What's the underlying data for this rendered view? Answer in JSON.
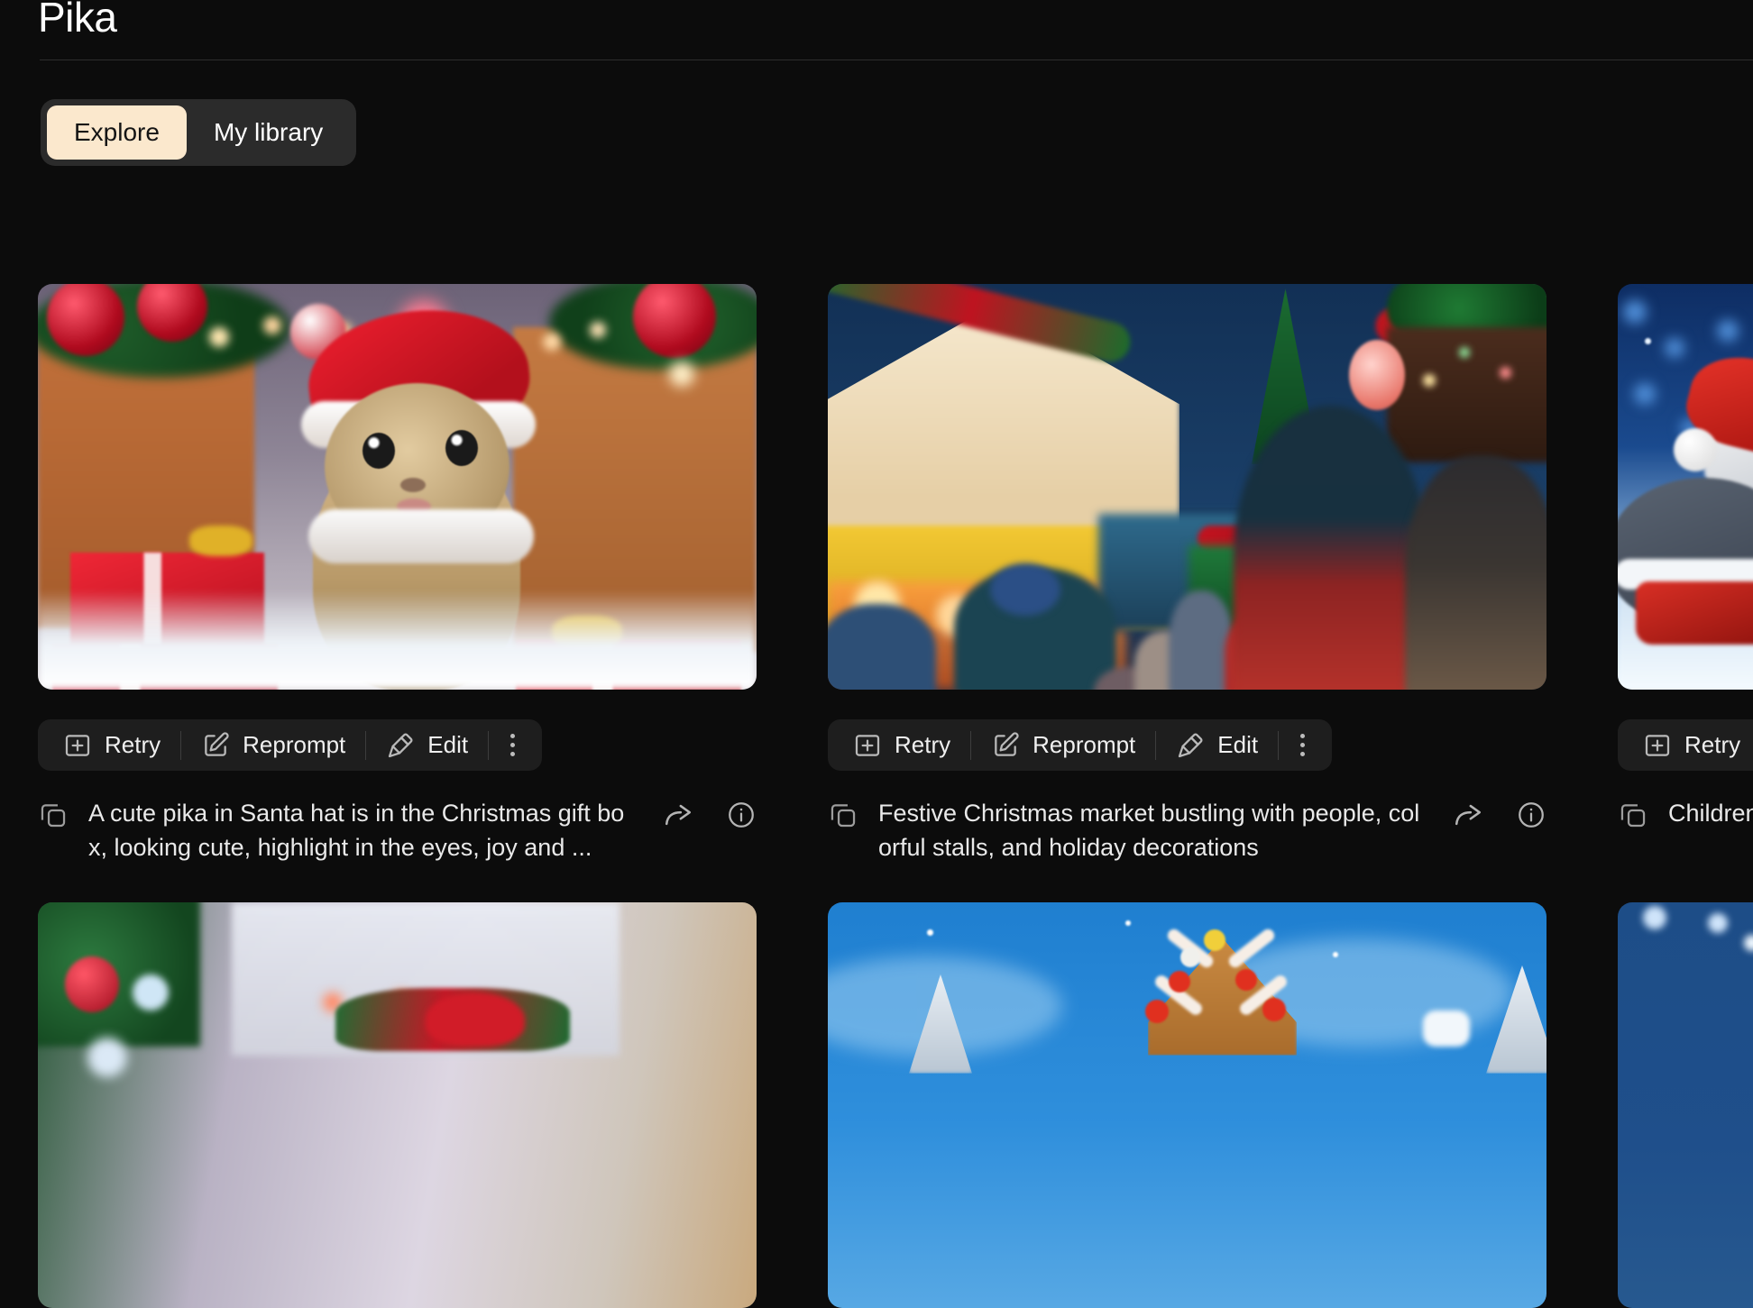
{
  "app": {
    "brand": "Pika",
    "background_color": "#0c0c0c",
    "accent_color": "#fbe8cd"
  },
  "tabs": {
    "items": [
      {
        "label": "Explore",
        "active": true
      },
      {
        "label": "My library",
        "active": false
      }
    ]
  },
  "actions": {
    "retry_label": "Retry",
    "reprompt_label": "Reprompt",
    "edit_label": "Edit",
    "more_label": "More options",
    "icons": {
      "retry": "add-to-box-icon",
      "reprompt": "pencil-square-icon",
      "edit": "paintbrush-icon",
      "more": "kebab-menu-icon",
      "copy": "copy-icon",
      "share": "share-arrow-icon",
      "info": "info-circle-icon"
    }
  },
  "feed": {
    "rows": [
      {
        "cards": [
          {
            "scene": "santa-pika-gift-box",
            "prompt": "A cute pika in Santa hat is in the Christmas gift box, looking cute, highlight in the eyes, joy and ..."
          },
          {
            "scene": "christmas-market",
            "prompt": "Festive Christmas market bustling with people, colorful stalls, and holiday decorations"
          },
          {
            "scene": "child-in-santa-hat",
            "prompt": "Children in Santa hat"
          }
        ]
      },
      {
        "cards": [
          {
            "scene": "christmas-tree-window-bow",
            "prompt": ""
          },
          {
            "scene": "gingerbread-house-snow",
            "prompt": ""
          },
          {
            "scene": "blue-night-snow",
            "prompt": ""
          }
        ]
      }
    ]
  }
}
